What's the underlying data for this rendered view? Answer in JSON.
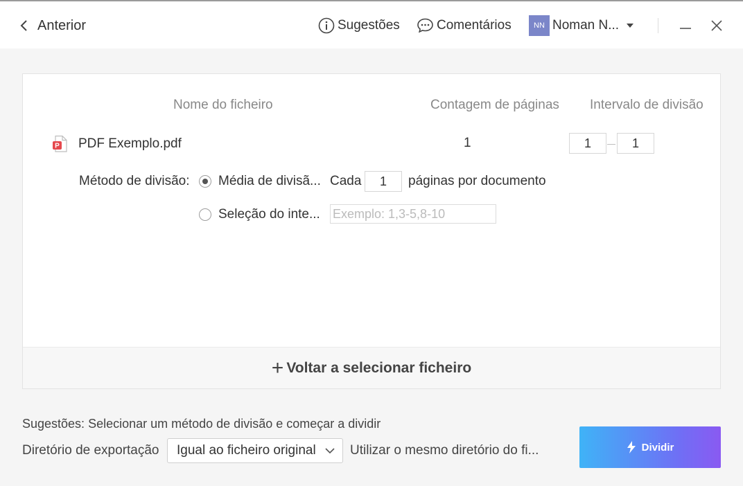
{
  "header": {
    "back_label": "Anterior",
    "suggestions_label": "Sugestões",
    "comments_label": "Comentários",
    "user_initials": "NN",
    "user_name": "Noman N..."
  },
  "table": {
    "headers": {
      "file_name": "Nome do ficheiro",
      "page_count": "Contagem de páginas",
      "split_range": "Intervalo de divisão"
    },
    "file": {
      "name": "PDF Exemplo.pdf",
      "pages": "1",
      "range_from": "1",
      "range_to": "1"
    }
  },
  "split_method": {
    "label": "Método de divisão:",
    "option_average": {
      "label": "Média de divisã...",
      "selected": true
    },
    "every_label": "Cada",
    "every_value": "1",
    "pages_per_doc_label": "páginas por documento",
    "option_range": {
      "label": "Seleção do inte...",
      "selected": false
    },
    "range_placeholder": "Exemplo: 1,3-5,8-10"
  },
  "reselect_label": "Voltar a selecionar ficheiro",
  "footer": {
    "tips_text": "Sugestões: Selecionar um método de divisão e começar a dividir",
    "export_dir_label": "Diretório de exportação",
    "export_dir_selected": "Igual ao ficheiro original",
    "export_dir_desc": "Utilizar o mesmo diretório do fi...",
    "split_button_label": "Dividir"
  },
  "colors": {
    "accent_gradient_start": "#3fb3f7",
    "accent_gradient_end": "#8a5af2",
    "avatar_bg": "#7b86c9",
    "pdf_icon_red": "#e5484d"
  }
}
